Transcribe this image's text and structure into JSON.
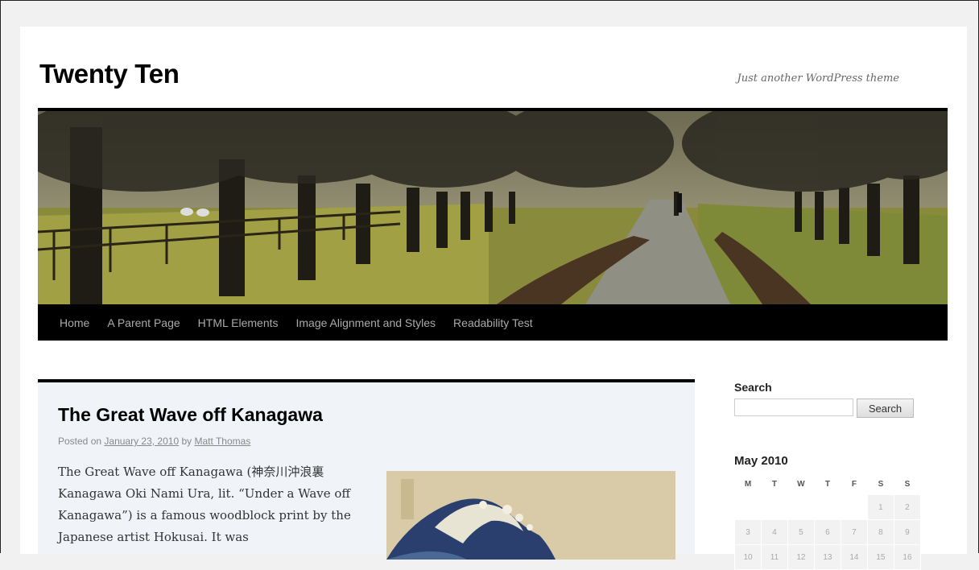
{
  "site": {
    "title": "Twenty Ten",
    "description": "Just another WordPress theme"
  },
  "nav": {
    "items": [
      "Home",
      "A Parent Page",
      "HTML Elements",
      "Image Alignment and Styles",
      "Readability Test"
    ]
  },
  "post": {
    "title": "The Great Wave off Kanagawa",
    "meta_prefix": "Posted on",
    "date": "January 23, 2010",
    "meta_by": "by",
    "author": "Matt Thomas",
    "body": "The Great Wave off Kanagawa (神奈川沖浪裏 Kanagawa Oki Nami Ura, lit. “Under a Wave off Kanagawa”) is a famous woodblock print by the Japanese artist Hokusai. It was"
  },
  "sidebar": {
    "search_title": "Search",
    "search_value": "",
    "search_button": "Search",
    "calendar_title": "May 2010",
    "weekdays": [
      "M",
      "T",
      "W",
      "T",
      "F",
      "S",
      "S"
    ],
    "weeks": [
      [
        "",
        "",
        "",
        "",
        "",
        "1",
        "2"
      ],
      [
        "3",
        "4",
        "5",
        "6",
        "7",
        "8",
        "9"
      ],
      [
        "10",
        "11",
        "12",
        "13",
        "14",
        "15",
        "16"
      ]
    ]
  }
}
